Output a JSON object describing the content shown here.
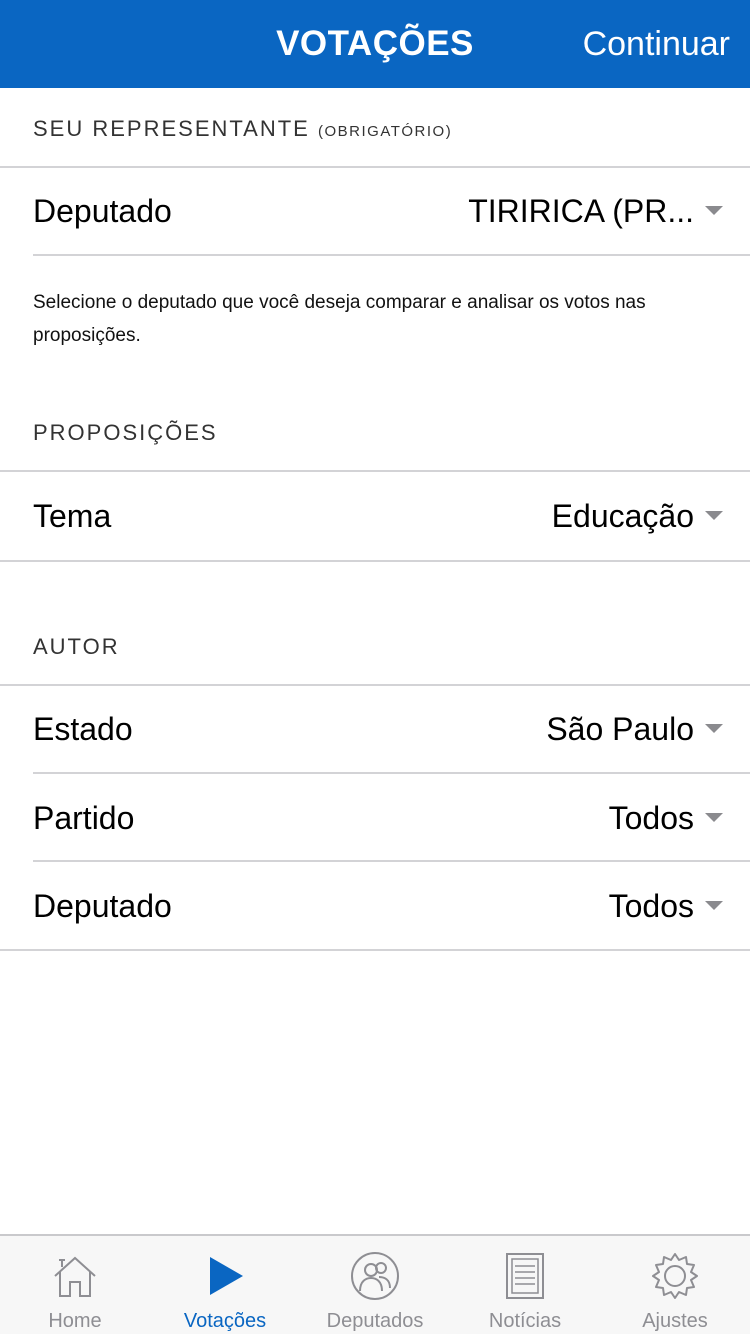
{
  "navbar": {
    "title": "VOTAÇÕES",
    "action_label": "Continuar",
    "background": "#0a66c2"
  },
  "representative_section": {
    "header": "SEU REPRESENTANTE",
    "header_note": "(OBRIGATÓRIO)",
    "rows": [
      {
        "label": "Deputado",
        "value": "TIRIRICA (PR..."
      }
    ],
    "helper_text": "Selecione o deputado que você deseja comparar e analisar os votos nas proposições."
  },
  "propositions_section": {
    "header": "PROPOSIÇÕES",
    "rows": [
      {
        "label": "Tema",
        "value": "Educação"
      }
    ]
  },
  "author_section": {
    "header": "AUTOR",
    "rows": [
      {
        "label": "Estado",
        "value": "São Paulo"
      },
      {
        "label": "Partido",
        "value": "Todos"
      },
      {
        "label": "Deputado",
        "value": "Todos"
      }
    ]
  },
  "tabbar": {
    "active": "Votações",
    "active_color": "#0a66c2",
    "items": [
      {
        "label": "Home",
        "icon": "home-icon"
      },
      {
        "label": "Votações",
        "icon": "play-icon"
      },
      {
        "label": "Deputados",
        "icon": "people-icon"
      },
      {
        "label": "Notícias",
        "icon": "newspaper-icon"
      },
      {
        "label": "Ajustes",
        "icon": "gear-icon"
      }
    ]
  }
}
